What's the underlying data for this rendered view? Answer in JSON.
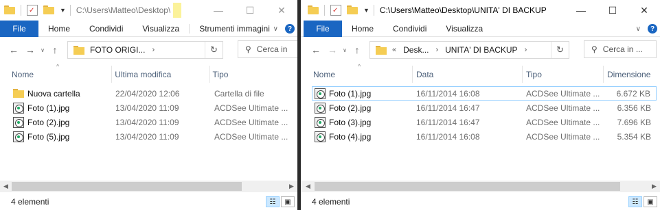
{
  "left": {
    "path": "C:\\Users\\Matteo\\Desktop\\",
    "ribbon": {
      "file": "File",
      "tabs": [
        "Home",
        "Condividi",
        "Visualizza",
        "Strumenti immagini"
      ]
    },
    "breadcrumb": [
      "FOTO ORIGI..."
    ],
    "search_placeholder": "Cerca in",
    "columns": [
      "Nome",
      "Ultima modifica",
      "Tipo"
    ],
    "rows": [
      {
        "name": "Nuova cartella",
        "date": "22/04/2020 12:06",
        "type": "Cartella di file",
        "icon": "folder-icon"
      },
      {
        "name": "Foto (1).jpg",
        "date": "13/04/2020 11:09",
        "type": "ACDSee Ultimate ...",
        "icon": "jpg-file-icon"
      },
      {
        "name": "Foto (2).jpg",
        "date": "13/04/2020 11:09",
        "type": "ACDSee Ultimate ...",
        "icon": "jpg-file-icon"
      },
      {
        "name": "Foto (5).jpg",
        "date": "13/04/2020 11:09",
        "type": "ACDSee Ultimate ...",
        "icon": "jpg-file-icon"
      }
    ],
    "status": "4 elementi"
  },
  "right": {
    "path": "C:\\Users\\Matteo\\Desktop\\UNITA' DI BACKUP",
    "ribbon": {
      "file": "File",
      "tabs": [
        "Home",
        "Condividi",
        "Visualizza"
      ]
    },
    "breadcrumb": [
      "Desk...",
      "UNITA' DI BACKUP"
    ],
    "search_placeholder": "Cerca in ...",
    "columns": [
      "Nome",
      "Data",
      "Tipo",
      "Dimensione"
    ],
    "rows": [
      {
        "name": "Foto (1).jpg",
        "date": "16/11/2014 16:08",
        "type": "ACDSee Ultimate ...",
        "size": "6.672 KB"
      },
      {
        "name": "Foto (2).jpg",
        "date": "16/11/2014 16:47",
        "type": "ACDSee Ultimate ...",
        "size": "6.356 KB"
      },
      {
        "name": "Foto (3).jpg",
        "date": "16/11/2014 16:47",
        "type": "ACDSee Ultimate ...",
        "size": "7.696 KB"
      },
      {
        "name": "Foto (4).jpg",
        "date": "16/11/2014 16:08",
        "type": "ACDSee Ultimate ...",
        "size": "5.354 KB"
      }
    ],
    "status": "4 elementi"
  },
  "colors": {
    "accent": "#1a66c2",
    "selection": "#99d1ff",
    "folder": "#f5cd54"
  }
}
